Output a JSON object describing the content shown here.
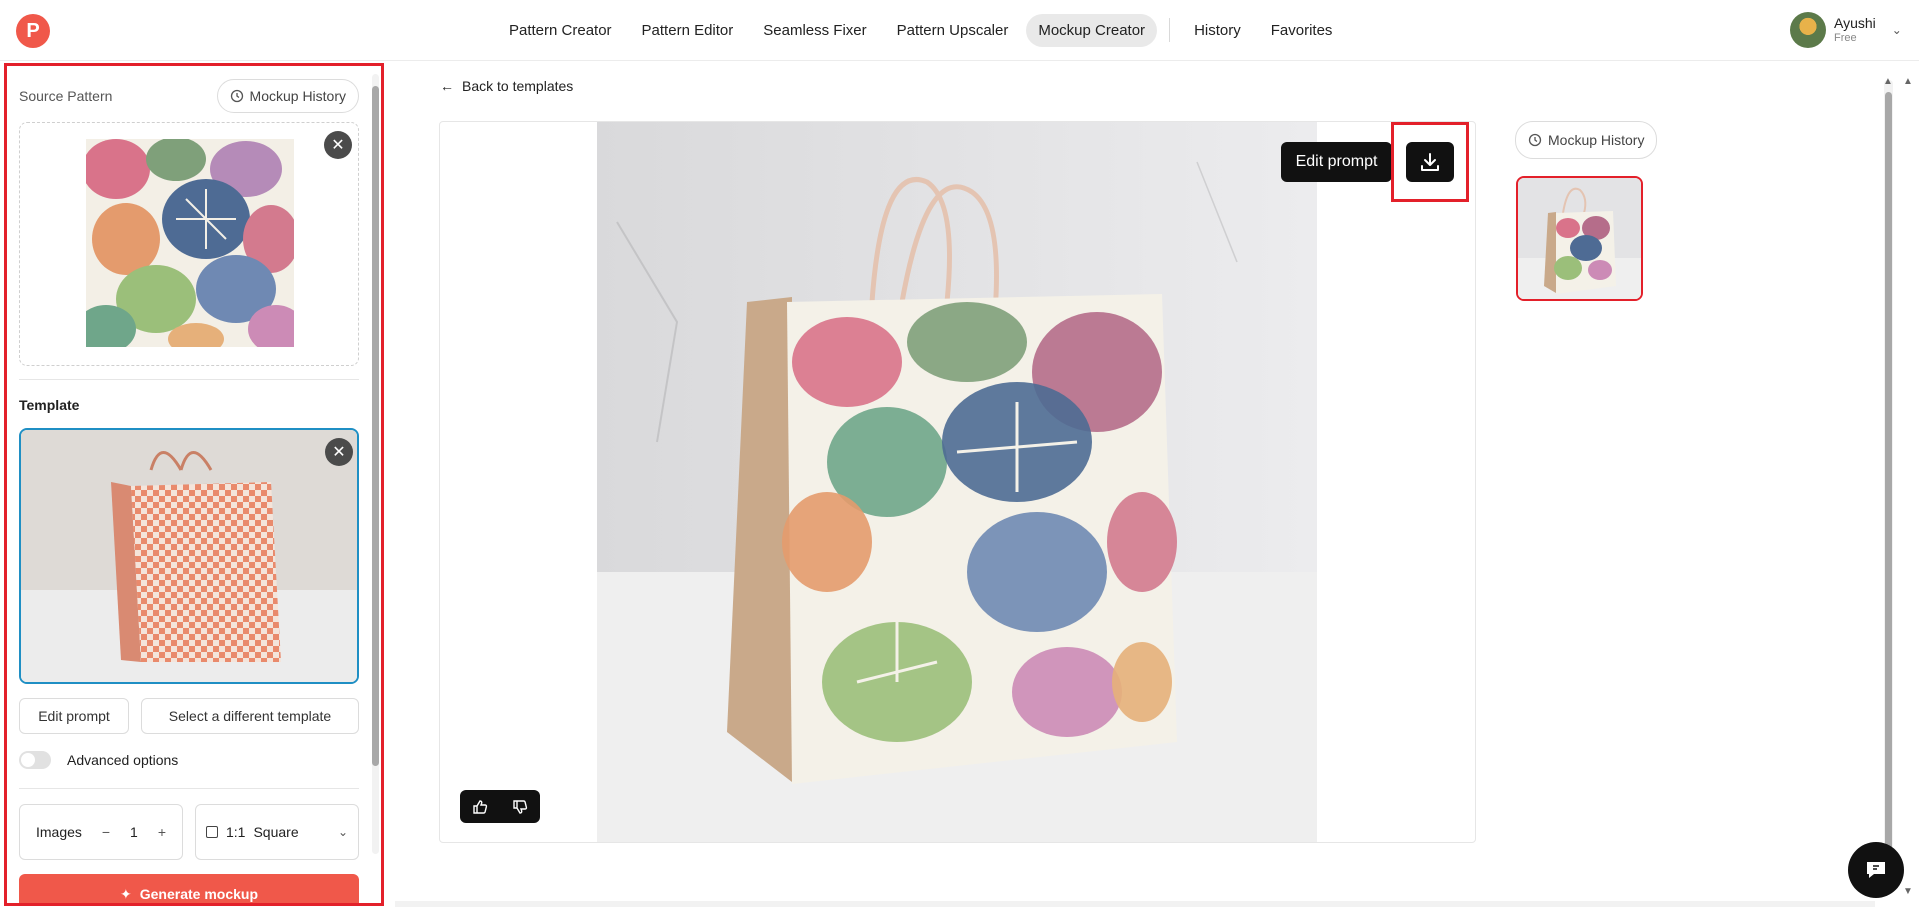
{
  "app": {
    "logo_letter": "P"
  },
  "nav": {
    "items": [
      "Pattern Creator",
      "Pattern Editor",
      "Seamless Fixer",
      "Pattern Upscaler",
      "Mockup Creator"
    ],
    "active": "Mockup Creator",
    "secondary": [
      "History",
      "Favorites"
    ]
  },
  "user": {
    "name": "Ayushi",
    "plan": "Free"
  },
  "left_panel": {
    "source_label": "Source Pattern",
    "mockup_history_label": "Mockup History",
    "template_label": "Template",
    "edit_prompt_label": "Edit prompt",
    "select_template_label": "Select a different template",
    "advanced_label": "Advanced options",
    "images_label": "Images",
    "images_count": "1",
    "aspect_ratio": "1:1",
    "aspect_name": "Square",
    "generate_label": "Generate mockup"
  },
  "main": {
    "back_label": "Back to templates",
    "edit_prompt_label": "Edit prompt"
  },
  "right_panel": {
    "mockup_history_label": "Mockup History"
  },
  "colors": {
    "accent": "#f0584a",
    "highlight": "#e3202a",
    "selected_border": "#1f8fc4"
  },
  "icons": [
    "history-icon",
    "close-icon",
    "download-icon",
    "thumbs-up-icon",
    "thumbs-down-icon",
    "sparkle-icon",
    "chat-icon",
    "chevron-down-icon",
    "arrow-left-icon",
    "minus-icon",
    "plus-icon"
  ]
}
